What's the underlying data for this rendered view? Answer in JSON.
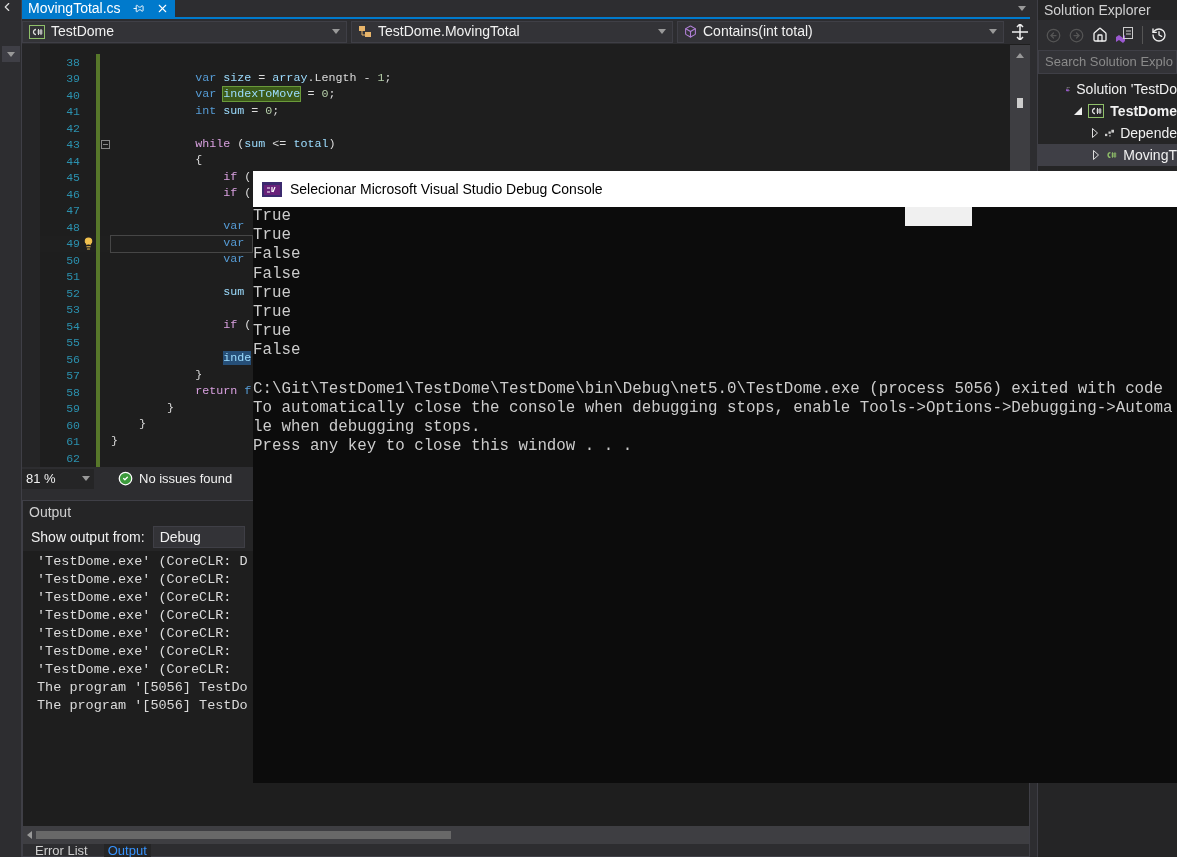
{
  "document_tab": {
    "title": "MovingTotal.cs",
    "selected": true
  },
  "nav_bar": [
    {
      "kind": "project",
      "text": "TestDome"
    },
    {
      "kind": "class",
      "text": "TestDome.MovingTotal"
    },
    {
      "kind": "method",
      "text": "Contains(int total)"
    }
  ],
  "code_lines": [
    {
      "number": "38",
      "current": false,
      "kind": "plain"
    },
    {
      "number": "39",
      "current": false,
      "kind": "plain",
      "tokens": [
        {
          "kind": "kw",
          "text": "            var"
        },
        {
          "kind": "ident",
          "text": " size"
        },
        {
          "kind": "plain",
          "text": " = "
        },
        {
          "kind": "ident",
          "text": "array"
        },
        {
          "kind": "plain",
          "text": ".Length - "
        },
        {
          "kind": "num",
          "text": "1"
        },
        {
          "kind": "plain",
          "text": ";"
        }
      ]
    },
    {
      "number": "40",
      "current": false,
      "kind": "plain",
      "tokens": [
        {
          "kind": "kw",
          "text": "            var "
        },
        {
          "kind": "highlight",
          "text": "indexToMove"
        },
        {
          "kind": "plain",
          "text": " = "
        },
        {
          "kind": "num",
          "text": "0"
        },
        {
          "kind": "plain",
          "text": ";"
        }
      ]
    },
    {
      "number": "41",
      "current": false,
      "kind": "plain",
      "tokens": [
        {
          "kind": "kw",
          "text": "            int"
        },
        {
          "kind": "ident",
          "text": " sum"
        },
        {
          "kind": "plain",
          "text": " = "
        },
        {
          "kind": "num",
          "text": "0"
        },
        {
          "kind": "plain",
          "text": ";"
        }
      ]
    },
    {
      "number": "42",
      "current": false,
      "kind": "plain"
    },
    {
      "number": "43",
      "current": false,
      "kind": "fold",
      "tokens": [
        {
          "kind": "ctl",
          "text": "            while"
        },
        {
          "kind": "plain",
          "text": " ("
        },
        {
          "kind": "ident",
          "text": "sum"
        },
        {
          "kind": "plain",
          "text": " <= "
        },
        {
          "kind": "ident",
          "text": "total"
        },
        {
          "kind": "plain",
          "text": ")"
        }
      ]
    },
    {
      "number": "44",
      "current": false,
      "kind": "plain",
      "tokens": [
        {
          "kind": "plain",
          "text": "            {"
        }
      ]
    },
    {
      "number": "45",
      "current": false,
      "kind": "plain",
      "tokens": [
        {
          "kind": "ctl",
          "text": "                if"
        },
        {
          "kind": "plain",
          "text": " ("
        }
      ]
    },
    {
      "number": "46",
      "current": false,
      "kind": "plain",
      "tokens": [
        {
          "kind": "ctl",
          "text": "                if"
        },
        {
          "kind": "plain",
          "text": " ("
        }
      ]
    },
    {
      "number": "47",
      "current": false,
      "kind": "plain"
    },
    {
      "number": "48",
      "current": false,
      "kind": "plain",
      "tokens": [
        {
          "kind": "kw",
          "text": "                var"
        }
      ]
    },
    {
      "number": "49",
      "current": true,
      "kind": "lightbulb",
      "tokens": [
        {
          "kind": "kw",
          "text": "                var"
        }
      ]
    },
    {
      "number": "50",
      "current": false,
      "kind": "plain",
      "tokens": [
        {
          "kind": "kw",
          "text": "                var"
        }
      ]
    },
    {
      "number": "51",
      "current": false,
      "kind": "plain"
    },
    {
      "number": "52",
      "current": false,
      "kind": "plain",
      "tokens": [
        {
          "kind": "ident",
          "text": "                sum"
        }
      ]
    },
    {
      "number": "53",
      "current": false,
      "kind": "plain"
    },
    {
      "number": "54",
      "current": false,
      "kind": "plain",
      "tokens": [
        {
          "kind": "ctl",
          "text": "                if"
        },
        {
          "kind": "plain",
          "text": " ("
        }
      ]
    },
    {
      "number": "55",
      "current": false,
      "kind": "plain"
    },
    {
      "number": "56",
      "current": false,
      "kind": "plain",
      "tokens": [
        {
          "kind": "selection",
          "text": "                inde"
        }
      ]
    },
    {
      "number": "57",
      "current": false,
      "kind": "plain",
      "tokens": [
        {
          "kind": "plain",
          "text": "            }"
        }
      ]
    },
    {
      "number": "58",
      "current": false,
      "kind": "plain",
      "tokens": [
        {
          "kind": "ctl",
          "text": "            return"
        },
        {
          "kind": "kw",
          "text": " f"
        }
      ]
    },
    {
      "number": "59",
      "current": false,
      "kind": "plain",
      "tokens": [
        {
          "kind": "plain",
          "text": "        }"
        }
      ]
    },
    {
      "number": "60",
      "current": false,
      "kind": "plain",
      "tokens": [
        {
          "kind": "plain",
          "text": "    }"
        }
      ]
    },
    {
      "number": "61",
      "current": false,
      "kind": "plain",
      "tokens": [
        {
          "kind": "plain",
          "text": "}"
        }
      ]
    },
    {
      "number": "62",
      "current": false,
      "kind": "plain"
    }
  ],
  "editor_status": {
    "zoom": "81 %",
    "issues": "No issues found"
  },
  "output_panel": {
    "title": "Output",
    "source_label": "Show output from:",
    "source": "Debug",
    "lines": [
      "'TestDome.exe' (CoreCLR: D",
      "'TestDome.exe' (CoreCLR:",
      "'TestDome.exe' (CoreCLR:",
      "'TestDome.exe' (CoreCLR:",
      "'TestDome.exe' (CoreCLR:",
      "'TestDome.exe' (CoreCLR:",
      "'TestDome.exe' (CoreCLR:",
      "The program '[5056] TestDo",
      "The program '[5056] TestDo"
    ]
  },
  "bottom_tabs": [
    {
      "label": "Error List",
      "selected": false
    },
    {
      "label": "Output",
      "selected": true
    }
  ],
  "solution_explorer": {
    "title": "Solution Explorer",
    "search_placeholder": "Search Solution Explo",
    "tree": [
      {
        "kind": "solution",
        "label": "Solution 'TestDo",
        "selected": false,
        "children": [
          {
            "kind": "project",
            "label": "TestDome",
            "selected": false,
            "expanded": true,
            "children": [
              {
                "kind": "dependencies",
                "label": "Depende",
                "selected": false,
                "expanded": false
              },
              {
                "kind": "csfile",
                "label": "MovingT",
                "selected": true,
                "expanded": false
              }
            ]
          }
        ]
      }
    ]
  },
  "console": {
    "title": "Selecionar Microsoft Visual Studio Debug Console",
    "results": [
      "True",
      "True",
      "False",
      "False",
      "True",
      "True",
      "True",
      "False"
    ],
    "messages": [
      "C:\\Git\\TestDome1\\TestDome\\TestDome\\bin\\Debug\\net5.0\\TestDome.exe (process 5056) exited with code",
      "To automatically close the console when debugging stops, enable Tools->Options->Debugging->Automa",
      "le when debugging stops.",
      "Press any key to close this window . . ."
    ]
  }
}
